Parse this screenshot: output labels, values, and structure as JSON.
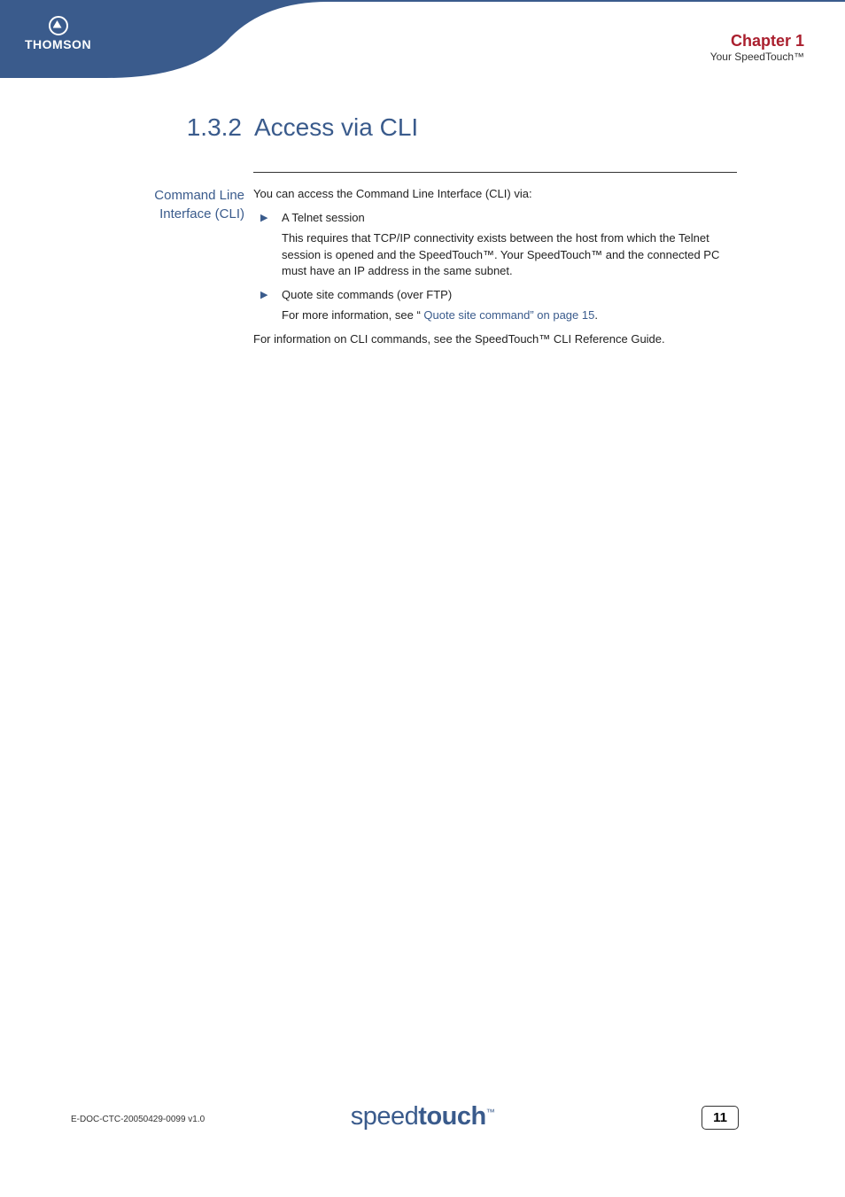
{
  "header": {
    "brand": "THOMSON",
    "chapter": "Chapter 1",
    "subtitle": "Your SpeedTouch™"
  },
  "section": {
    "number": "1.3.2",
    "title": "Access via CLI"
  },
  "sidebar_label": "Command Line Interface (CLI)",
  "body": {
    "intro": "You can access the Command Line Interface (CLI) via:",
    "items": [
      {
        "label": "A Telnet session",
        "para": "This requires that TCP/IP connectivity exists between the host from which the Telnet session is opened and the SpeedTouch™. Your SpeedTouch™ and the connected PC must have an IP address in the same subnet."
      },
      {
        "label": "Quote site commands (over FTP)",
        "para_prefix": "For more information, see “",
        "link": " Quote site command” on page 15",
        "para_suffix": "."
      }
    ],
    "outro": "For information on CLI commands, see the SpeedTouch™ CLI Reference Guide."
  },
  "footer": {
    "doc_id": "E-DOC-CTC-20050429-0099 v1.0",
    "logo_light": "speed",
    "logo_bold": "touch",
    "logo_tm": "™",
    "page": "11"
  }
}
